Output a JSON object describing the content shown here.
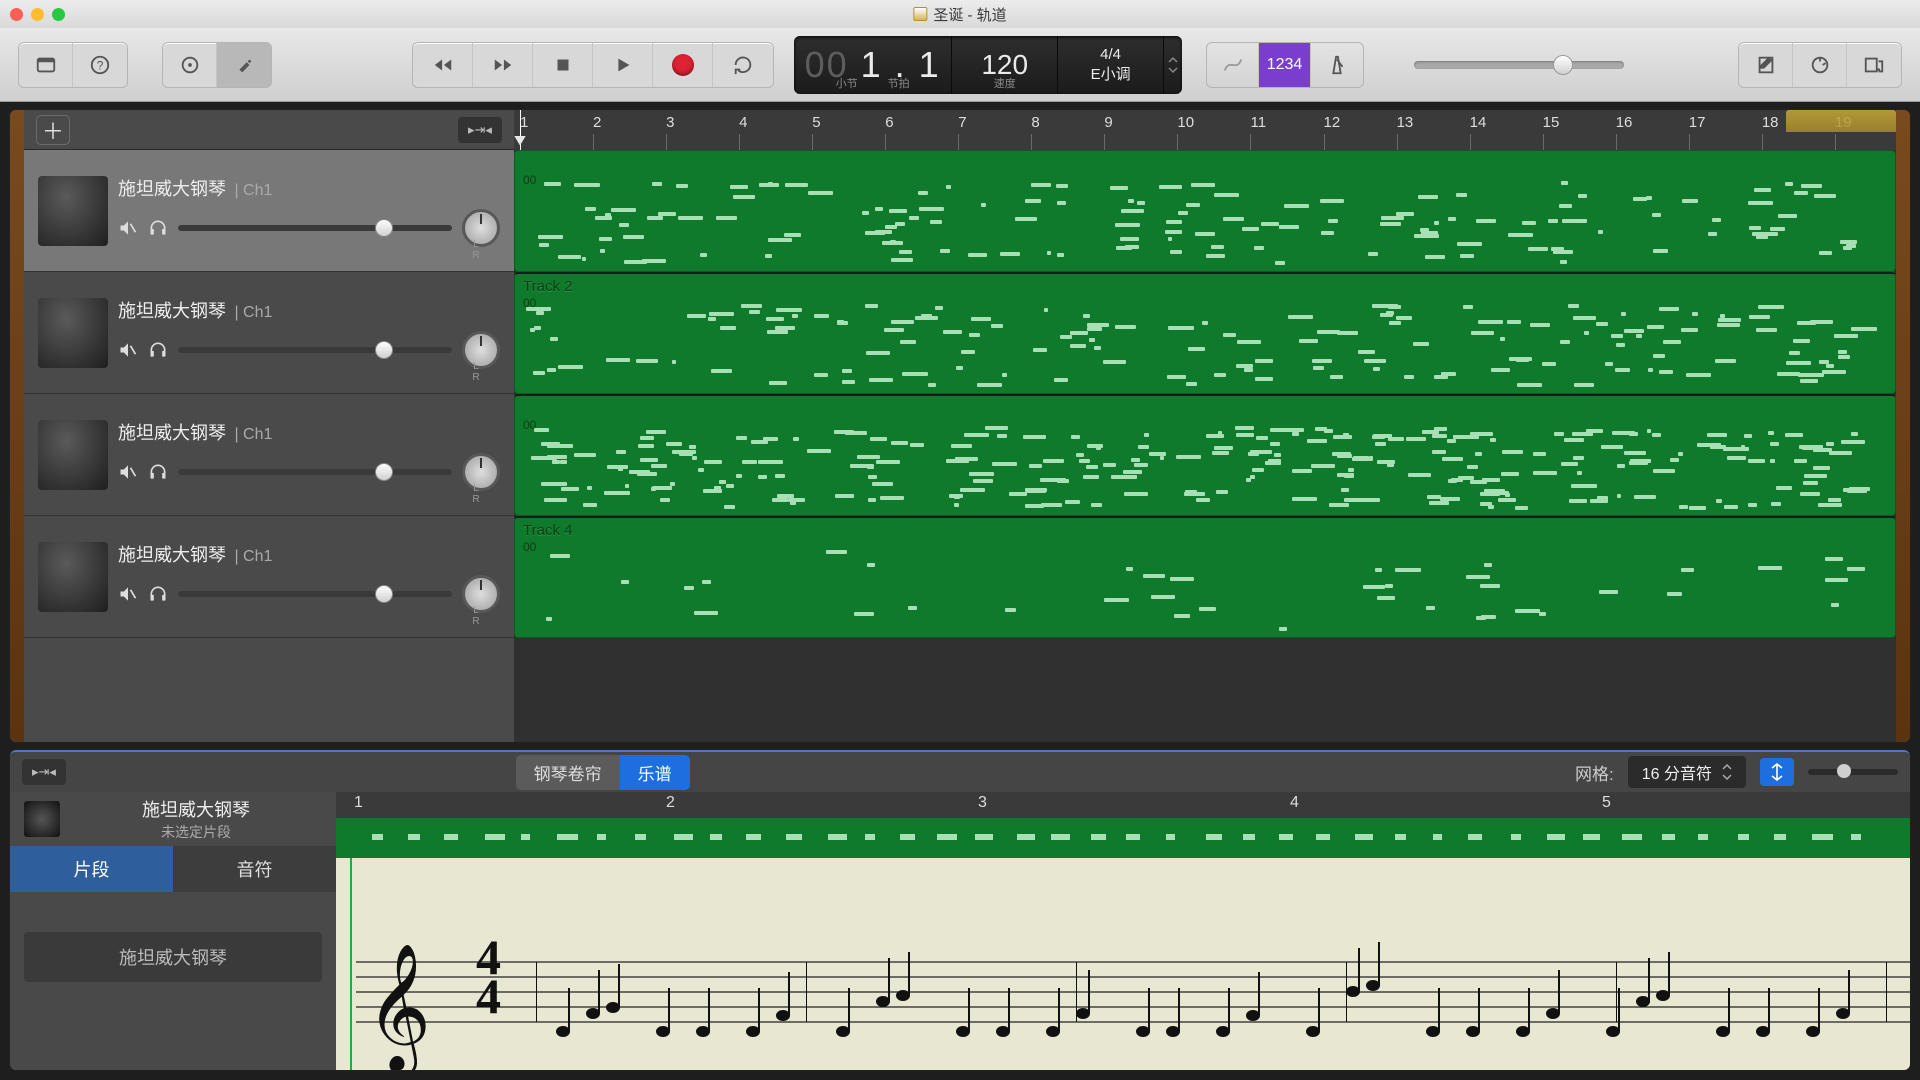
{
  "window": {
    "title": "圣诞 - 轨道"
  },
  "toolbar": {
    "countin": "1234"
  },
  "lcd": {
    "pos_dim": "00",
    "pos": "1 . 1",
    "pos_l": "小节",
    "pos_r": "节拍",
    "tempo": "120",
    "tempo_l": "速度",
    "sig": "4/4",
    "key": "E小调"
  },
  "ruler": {
    "measures": [
      "1",
      "2",
      "3",
      "4",
      "5",
      "6",
      "7",
      "8",
      "9",
      "10",
      "11",
      "12",
      "13",
      "14",
      "15",
      "16",
      "17",
      "18",
      "19"
    ]
  },
  "tracks": [
    {
      "name": "施坦威大钢琴",
      "ch": "Ch1",
      "selected": true,
      "region_label": "",
      "oo": "00"
    },
    {
      "name": "施坦威大钢琴",
      "ch": "Ch1",
      "selected": false,
      "region_label": "Track 2",
      "oo": "00"
    },
    {
      "name": "施坦威大钢琴",
      "ch": "Ch1",
      "selected": false,
      "region_label": "",
      "oo": "00"
    },
    {
      "name": "施坦威大钢琴",
      "ch": "Ch1",
      "selected": false,
      "region_label": "Track 4",
      "oo": "00"
    }
  ],
  "editor": {
    "catch": "▸⇥◂",
    "tab_pianoroll": "钢琴卷帘",
    "tab_score": "乐谱",
    "grid_label": "网格:",
    "grid_value": "16 分音符",
    "instr_name": "施坦威大钢琴",
    "instr_sub": "未选定片段",
    "tab_region": "片段",
    "tab_note": "音符",
    "instr_big": "施坦威大钢琴",
    "ruler": [
      "1",
      "2",
      "3",
      "4",
      "5"
    ]
  }
}
